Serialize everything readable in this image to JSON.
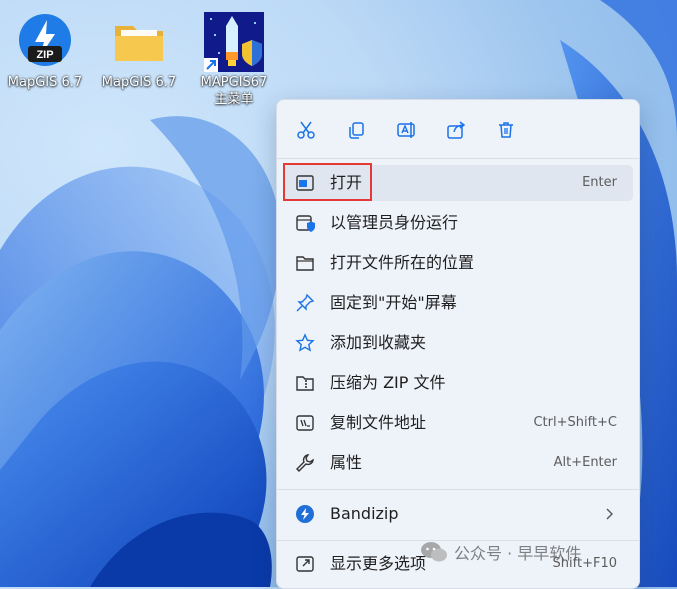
{
  "desktop": {
    "icons": [
      {
        "label": "MapGIS 6.7",
        "badge": "ZIP",
        "icon": "bandizip-archive-icon"
      },
      {
        "label": "MapGIS 6.7",
        "icon": "folder-icon"
      },
      {
        "label_line1": "MAPGIS67",
        "label_line2": "主菜单",
        "icon": "mapgis-shortcut-icon"
      }
    ]
  },
  "context_menu": {
    "toolbar": [
      {
        "name": "cut",
        "icon": "scissors-icon"
      },
      {
        "name": "copy",
        "icon": "copy-icon"
      },
      {
        "name": "rename",
        "icon": "rename-icon"
      },
      {
        "name": "share",
        "icon": "share-icon"
      },
      {
        "name": "delete",
        "icon": "trash-icon"
      }
    ],
    "items": [
      {
        "label": "打开",
        "shortcut": "Enter",
        "icon": "open-window-icon"
      },
      {
        "label": "以管理员身份运行",
        "shortcut": "",
        "icon": "admin-shield-icon"
      },
      {
        "label": "打开文件所在的位置",
        "shortcut": "",
        "icon": "folder-outline-icon"
      },
      {
        "label": "固定到\"开始\"屏幕",
        "shortcut": "",
        "icon": "pin-icon"
      },
      {
        "label": "添加到收藏夹",
        "shortcut": "",
        "icon": "star-icon"
      },
      {
        "label": "压缩为 ZIP 文件",
        "shortcut": "",
        "icon": "zip-folder-icon"
      },
      {
        "label": "复制文件地址",
        "shortcut": "Ctrl+Shift+C",
        "icon": "copy-path-icon"
      },
      {
        "label": "属性",
        "shortcut": "Alt+Enter",
        "icon": "wrench-icon"
      },
      {
        "label": "Bandizip",
        "shortcut": "",
        "icon": "bandizip-icon"
      },
      {
        "label": "显示更多选项",
        "shortcut": "Shift+F10",
        "icon": "more-options-icon"
      }
    ]
  },
  "watermark": {
    "text": "公众号 · 早早软件"
  },
  "colors": {
    "accent": "#1a73e8",
    "highlight": "#e53935",
    "menu_bg": "#eef2f9"
  }
}
